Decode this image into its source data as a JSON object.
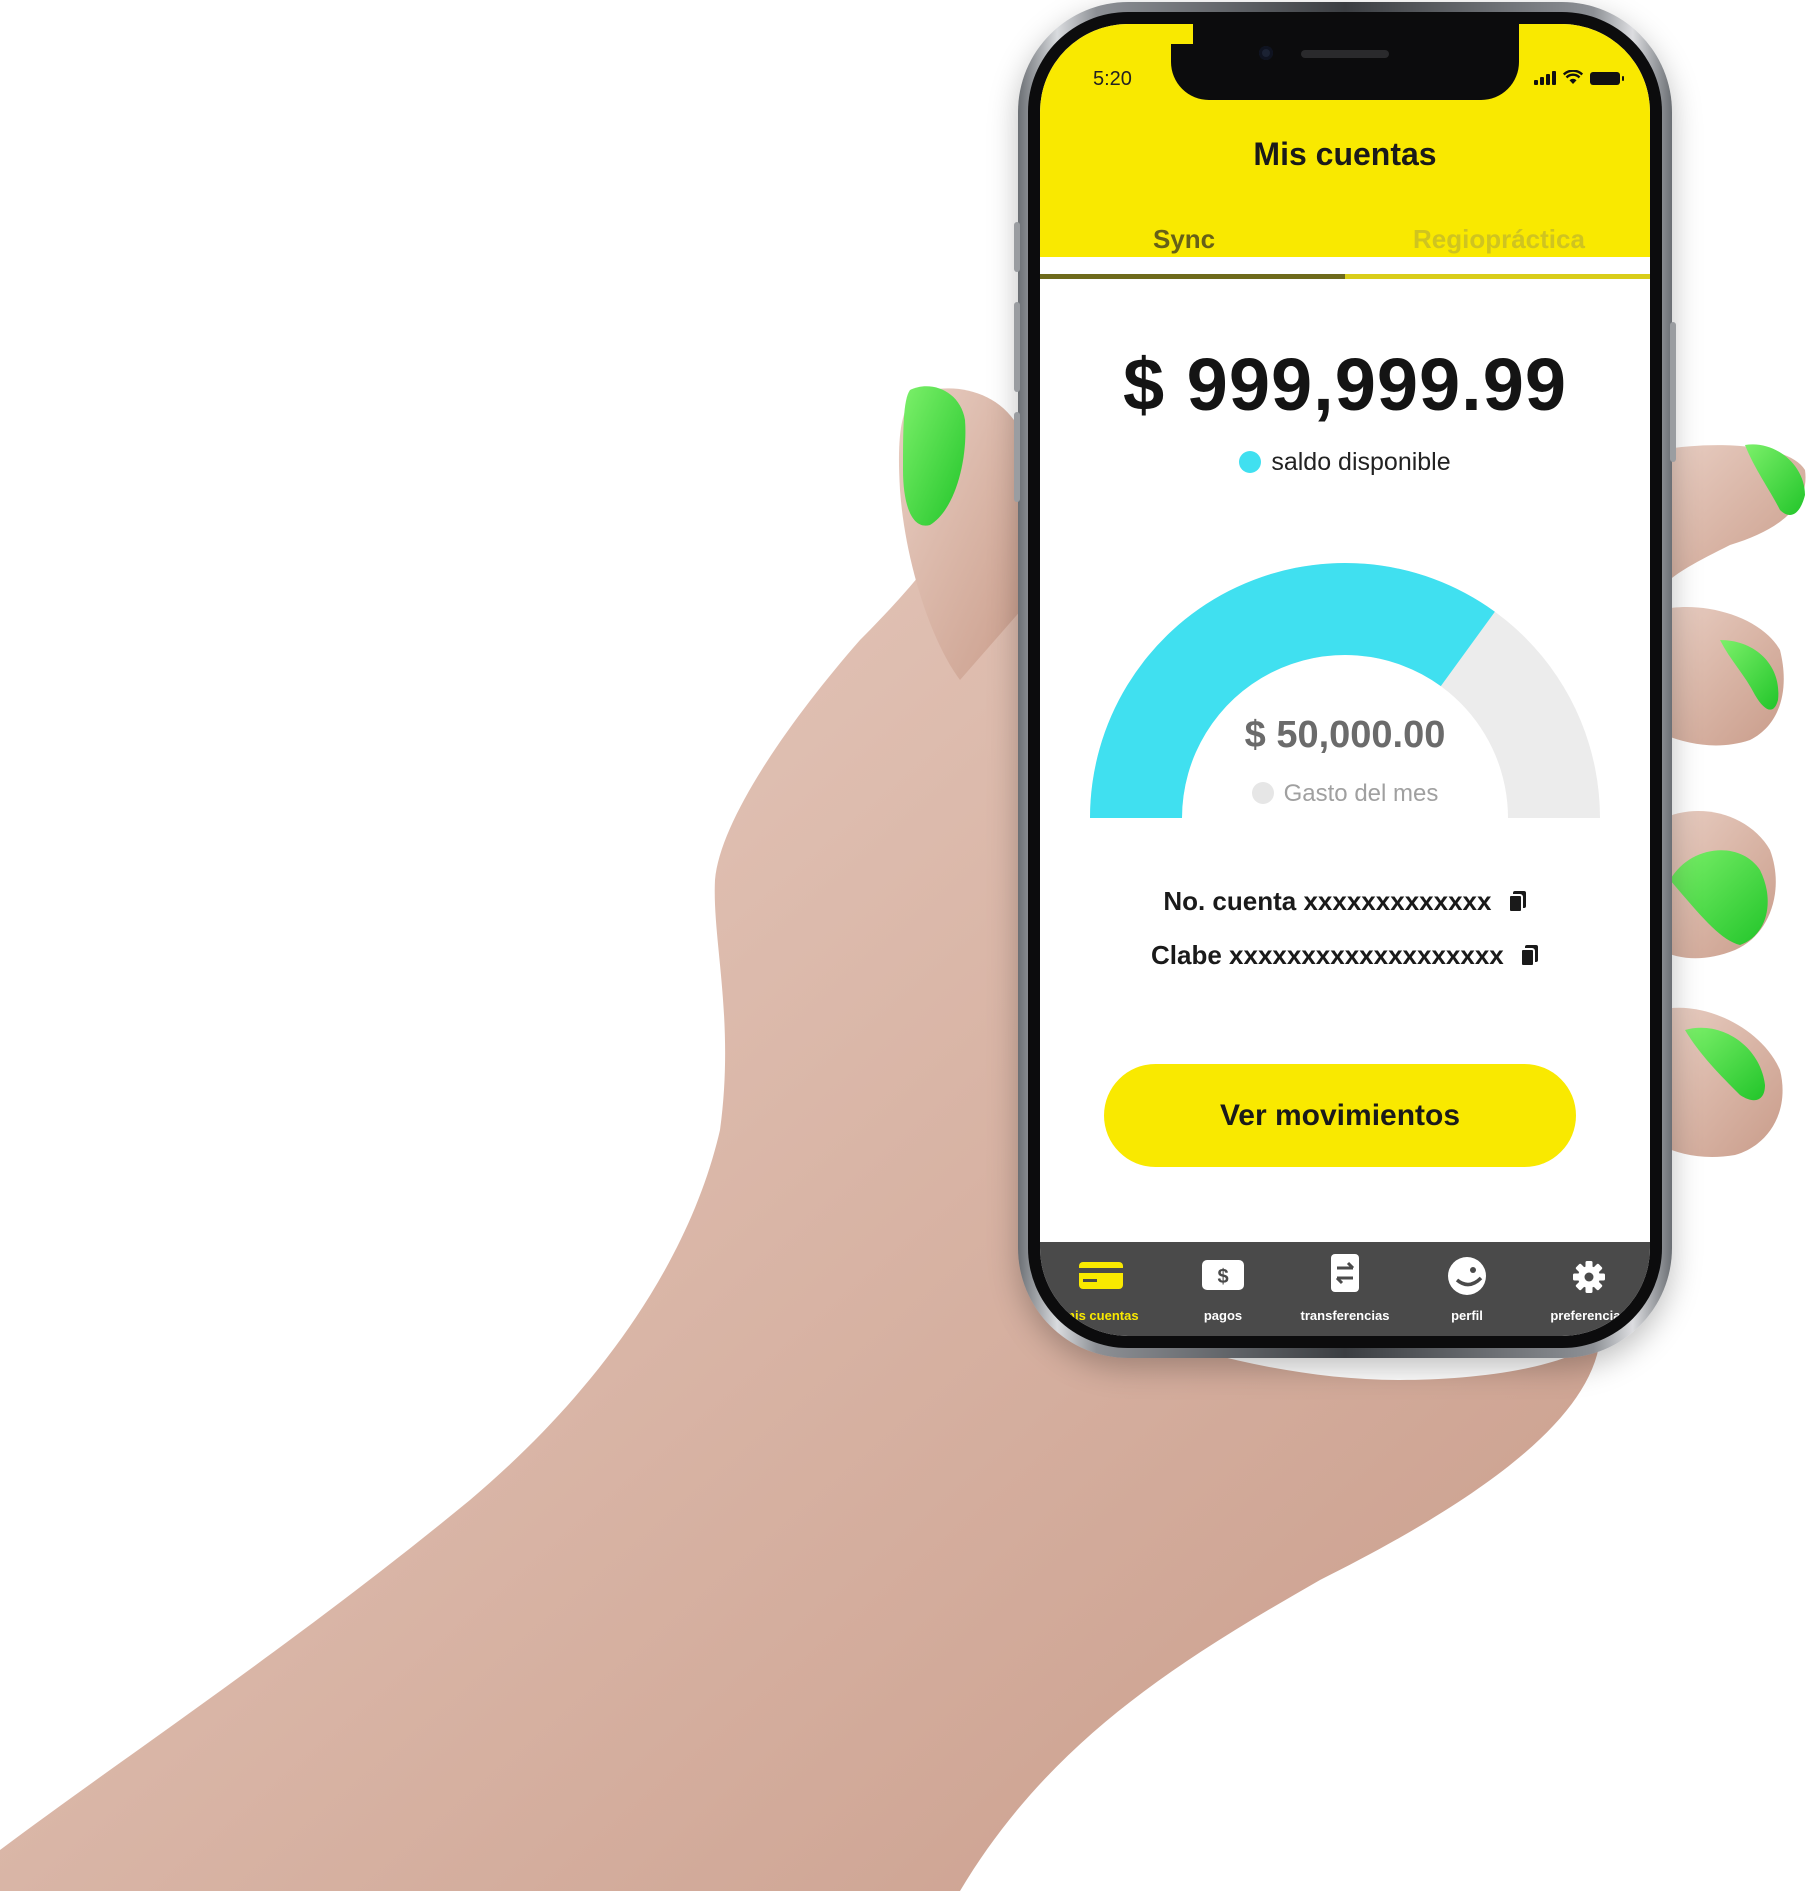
{
  "status_bar": {
    "time": "5:20"
  },
  "header": {
    "title": "Mis cuentas",
    "tabs": [
      {
        "label": "Sync",
        "active": true
      },
      {
        "label": "Regiopráctica",
        "active": false
      }
    ]
  },
  "balance": {
    "amount": "$ 999,999.99",
    "label": "saldo disponible",
    "dot_color": "#40e0f0"
  },
  "gauge": {
    "spent_amount": "$ 50,000.00",
    "spent_label": "Gasto del mes",
    "filled_fraction": 0.7,
    "fill_color": "#40e0f0",
    "track_color": "#ececec"
  },
  "account": {
    "number_label": "No. cuenta",
    "number_value": "xxxxxxxxxxxxx",
    "clabe_label": "Clabe",
    "clabe_value": "xxxxxxxxxxxxxxxxxxx"
  },
  "cta": {
    "label": "Ver movimientos"
  },
  "nav": {
    "items": [
      {
        "label": "mis cuentas",
        "icon": "card-icon",
        "active": true
      },
      {
        "label": "pagos",
        "icon": "dollar-icon",
        "active": false
      },
      {
        "label": "transferencias",
        "icon": "transfer-icon",
        "active": false
      },
      {
        "label": "perfil",
        "icon": "face-icon",
        "active": false
      },
      {
        "label": "preferencias",
        "icon": "gear-icon",
        "active": false
      }
    ]
  },
  "colors": {
    "brand_yellow": "#f9e900",
    "accent_cyan": "#40e0f0",
    "nail_green": "#3ee641",
    "nav_bg": "#4a4a4a"
  }
}
